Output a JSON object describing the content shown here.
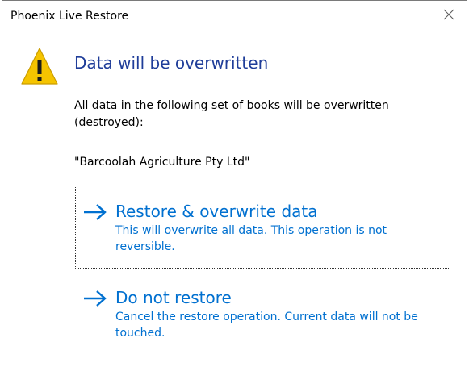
{
  "window": {
    "title": "Phoenix Live Restore",
    "close_icon": "close-icon"
  },
  "warning": {
    "icon": "warning-icon",
    "icon_color": "#f5c400"
  },
  "dialog": {
    "heading": "Data will be overwritten",
    "message": "All data in the following set of books will be overwritten (destroyed):",
    "company": "\"Barcoolah Agriculture Pty Ltd\""
  },
  "options": [
    {
      "label": "Restore & overwrite data",
      "note": "This will overwrite all data. This operation is not reversible.",
      "icon": "arrow-right-icon",
      "focused": true
    },
    {
      "label": "Do not restore",
      "note": "Cancel the restore operation. Current data will not be touched.",
      "icon": "arrow-right-icon",
      "focused": false
    }
  ],
  "colors": {
    "heading": "#1f3d99",
    "link": "#0070d0",
    "background": "#ffffff"
  }
}
